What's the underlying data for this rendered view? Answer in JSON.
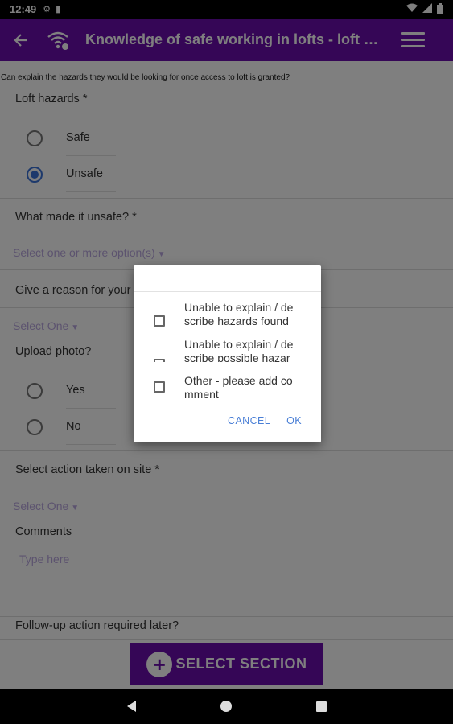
{
  "status_bar": {
    "time": "12:49"
  },
  "app_bar": {
    "back_icon": "arrow-left-icon",
    "title": "Knowledge of safe working in lofts - loft …",
    "menu_icon": "hamburger-menu-icon"
  },
  "form": {
    "description": "Can explain the hazards they would be looking for once access to loft is granted?",
    "loft_hazards": {
      "label": "Loft hazards *",
      "options": [
        "Safe",
        "Unsafe"
      ],
      "selected": "Unsafe"
    },
    "unsafe_reason": {
      "label": "What made it unsafe? *",
      "placeholder": "Select one or more option(s)"
    },
    "give_reason": {
      "label": "Give a reason for your",
      "placeholder": "Select One"
    },
    "upload_photo": {
      "label": "Upload photo?",
      "options": [
        "Yes",
        "No"
      ]
    },
    "action_taken": {
      "label": "Select action taken on site *",
      "placeholder": "Select One"
    },
    "comments": {
      "label": "Comments",
      "placeholder": "Type here"
    },
    "follow_up": {
      "label": "Follow-up action required later?"
    }
  },
  "select_section_button": {
    "label": "SELECT SECTION"
  },
  "dialog": {
    "options": [
      "Unable to explain / de scribe hazards found",
      "Unable to explain / de scribe possible hazar",
      "Other - please add co mment"
    ],
    "cancel_label": "CANCEL",
    "ok_label": "OK"
  },
  "colors": {
    "primary": "#6a0dad",
    "accent": "#3b73d9",
    "placeholder": "#b9a6df"
  }
}
